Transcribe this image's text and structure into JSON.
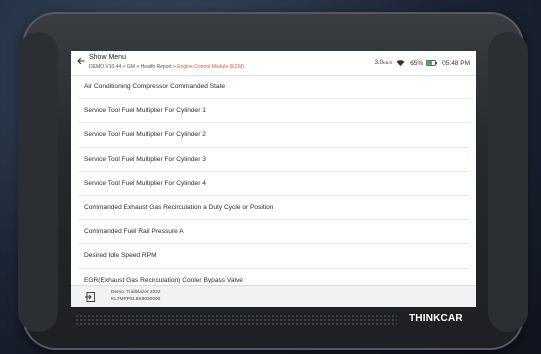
{
  "header": {
    "title": "Show Menu",
    "breadcrumb_path": "DEMO V10.44 > GM > Health Report > ",
    "breadcrumb_active": "Engine Control Module (ECM)"
  },
  "status_bar": {
    "speed_value": "3.0",
    "speed_unit": "KB/S",
    "battery": "65%",
    "time": "05:48",
    "time_period": "PM",
    "battery_color": "#3cb043"
  },
  "items": [
    {
      "label": "Air Conditioning Compressor Commanded State"
    },
    {
      "label": "Service Tool Fuel Multiplier For Cylinder 1"
    },
    {
      "label": "Service Tool Fuel Multiplier For Cylinder 2"
    },
    {
      "label": "Service Tool Fuel Multiplier For Cylinder 3"
    },
    {
      "label": "Service Tool Fuel Multiplier For Cylinder 4"
    },
    {
      "label": "Commanded Exhaust Gas Recirculation a Duty Cycle or Position"
    },
    {
      "label": "Commanded Fuel Rail Pressure A"
    },
    {
      "label": "Desired Idle Speed RPM"
    },
    {
      "label": "EGR(Exhaust Gas Recirculation) Cooler Bypass Valve"
    }
  ],
  "footer": {
    "vehicle_line1": "Demo: Trailblazer 2022",
    "vehicle_line2": "KL7MPPSL8K8030000"
  },
  "device": {
    "brand": "THINKCAR",
    "accent_color": "#e8542a"
  },
  "icons": {
    "back": "back-arrow-icon",
    "wifi": "wifi-icon",
    "battery": "battery-icon",
    "exit": "exit-icon"
  }
}
